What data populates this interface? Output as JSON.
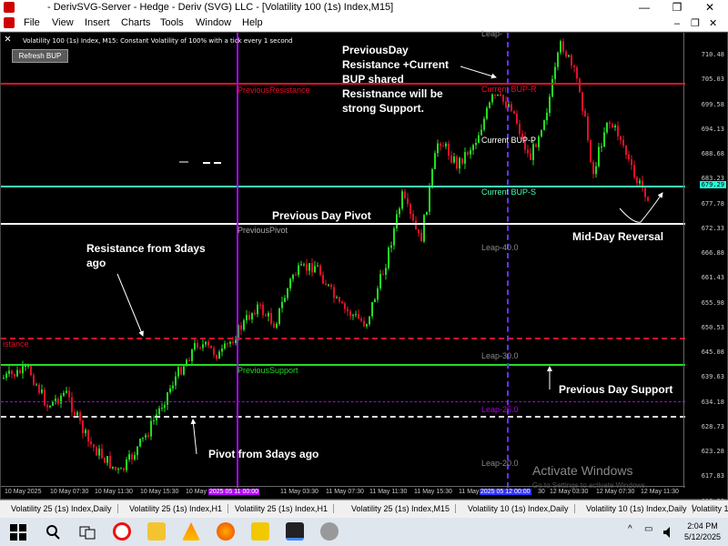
{
  "window": {
    "title": " - DerivSVG-Server - Hedge - Deriv (SVG) LLC - [Volatility 100 (1s) Index,M15]",
    "minimize": "—",
    "restore": "❐",
    "close": "✕"
  },
  "menu": [
    "File",
    "View",
    "Insert",
    "Charts",
    "Tools",
    "Window",
    "Help"
  ],
  "mdi": {
    "minimize": "–",
    "restore": "❐",
    "close": "✕"
  },
  "chart": {
    "header": "Volatility 100 (1s) Index, M15:  Constant Volatility of 100% with a tick every 1 second",
    "refresh_button": "Refresh BUP",
    "prices": [
      "710.48",
      "705.03",
      "699.58",
      "694.13",
      "688.68",
      "683.23",
      "677.78",
      "672.33",
      "666.88",
      "661.43",
      "655.98",
      "650.53",
      "645.08",
      "639.63",
      "634.18",
      "628.73",
      "623.28",
      "617.83",
      "612.38"
    ],
    "current_price": "679.29",
    "times": [
      "10 May 2025",
      "10 May 07:30",
      "10 May 11:30",
      "10 May 15:30",
      "10 May",
      "11 May 03:30",
      "11 May 07:30",
      "11 May 11:30",
      "11 May 15:30",
      "11 May",
      "30",
      "12 May 03:30",
      "12 May 07:30",
      "12 May 11:30"
    ],
    "time_highlight_1": "2025 05 11 00:00",
    "time_highlight_2": "2025 05 12 00:00",
    "lines": {
      "prev_resistance": "PreviousResistance",
      "current_bup_r": "Current BUP-R",
      "current_bup_p": "Current BUP-P",
      "current_bup_s": "Current BUP-S",
      "prev_pivot": "PreviousPivot",
      "prev_support": "PreviousSupport",
      "resistance_left": "istance",
      "leap_40": "Leap-40.0",
      "leap_30": "Leap-30.0",
      "leap_25": "Leap-25.0",
      "leap_20": "Leap-20.0",
      "leap_top": "Leap-"
    },
    "annotations": {
      "prevday_res": "PreviousDay Resistance +Current BUP shared Resistnance will be strong Support.",
      "prev_day_pivot": "Previous Day Pivot",
      "mid_day_reversal": "Mid-Day Reversal",
      "resistance_3days": "Resistance from 3days ago",
      "prev_day_support": "Previous Day Support",
      "pivot_3days": "Pivot from 3days ago"
    },
    "watermark": "Activate Windows",
    "watermark_sub": "Go to Settings to activate Windows."
  },
  "tabs": [
    "Volatility 25 (1s) Index,Daily",
    "Volatility 25 (1s) Index,H1",
    "Volatility 25 (1s) Index,H1",
    "Volatility 25 (1s) Index,M15",
    "Volatility 10 (1s) Index,Daily",
    "Volatility 10 (1s) Index,Daily",
    "Volatility 1"
  ],
  "taskbar": {
    "time": "2:04 PM",
    "date": "5/12/2025",
    "tray_chevron": "^",
    "tray_network": "▭"
  },
  "colors": {
    "red": "#e0102a",
    "green": "#22dd22",
    "white": "#ffffff",
    "magenta": "#b000ff",
    "blue": "#3333ff",
    "current_s": "#40ffb0"
  }
}
